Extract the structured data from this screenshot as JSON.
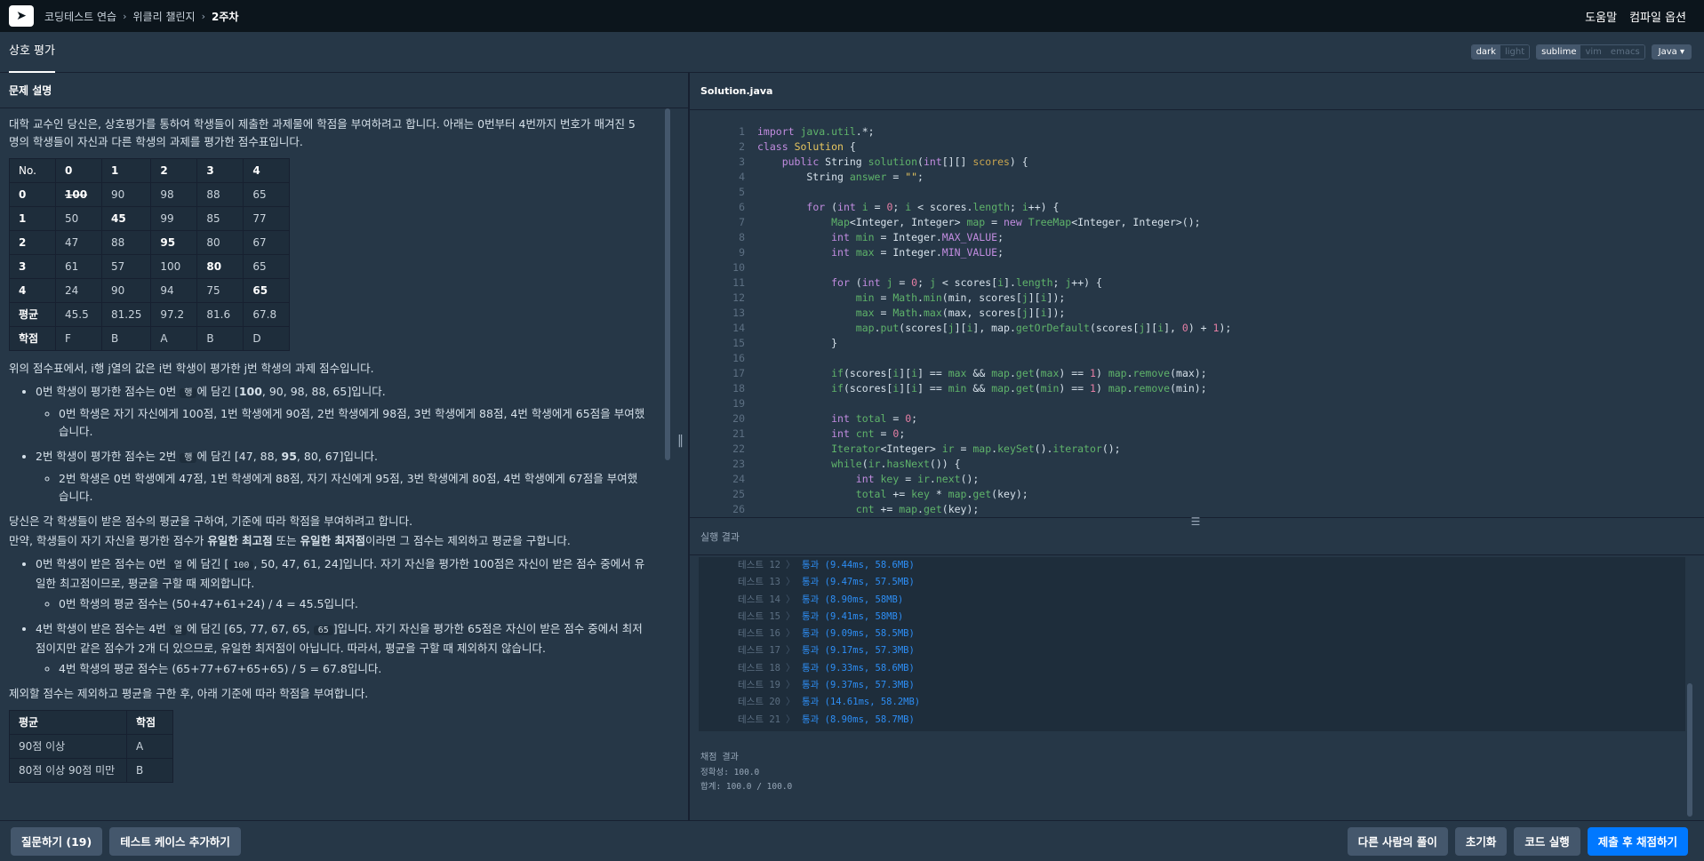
{
  "nav": {
    "crumbs": [
      "코딩테스트 연습",
      "위클리 챌린지",
      "2주차"
    ],
    "help": "도움말",
    "compile_options": "컴파일 옵션"
  },
  "subheader": {
    "tab": "상호 평가",
    "themes": [
      "dark",
      "light"
    ],
    "theme_selected": "dark",
    "keymaps": [
      "sublime",
      "vim",
      "emacs"
    ],
    "keymap_selected": "sublime",
    "language": "Java"
  },
  "problem": {
    "section_title": "문제 설명",
    "intro": "대학 교수인 당신은, 상호평가를 통하여 학생들이 제출한 과제물에 학점을 부여하려고 합니다. 아래는 0번부터 4번까지 번호가 매겨진 5명의 학생들이 자신과 다른 학생의 과제를 평가한 점수표입니다.",
    "score_table": {
      "header": [
        "No.",
        "0",
        "1",
        "2",
        "3",
        "4"
      ],
      "rows": [
        [
          "0",
          "100",
          "90",
          "98",
          "88",
          "65"
        ],
        [
          "1",
          "50",
          "45",
          "99",
          "85",
          "77"
        ],
        [
          "2",
          "47",
          "88",
          "95",
          "80",
          "67"
        ],
        [
          "3",
          "61",
          "57",
          "100",
          "80",
          "65"
        ],
        [
          "4",
          "24",
          "90",
          "94",
          "75",
          "65"
        ],
        [
          "평균",
          "45.5",
          "81.25",
          "97.2",
          "81.6",
          "67.8"
        ],
        [
          "학점",
          "F",
          "B",
          "A",
          "B",
          "D"
        ]
      ]
    },
    "table_note": "위의 점수표에서, i행 j열의 값은 i번 학생이 평가한 j번 학생의 과제 점수입니다.",
    "ex1_a": "0번 학생이 평가한 점수는 0번 ",
    "ex1_tag": "행",
    "ex1_b": "에 담긴 [",
    "ex1_bold": "100",
    "ex1_c": ", 90, 98, 88, 65]입니다.",
    "ex1_sub": "0번 학생은 자기 자신에게 100점, 1번 학생에게 90점, 2번 학생에게 98점, 3번 학생에게 88점, 4번 학생에게 65점을 부여했습니다.",
    "ex2_a": "2번 학생이 평가한 점수는 2번 ",
    "ex2_tag": "행",
    "ex2_b": "에 담긴 [47, 88, ",
    "ex2_bold": "95",
    "ex2_c": ", 80, 67]입니다.",
    "ex2_sub": "2번 학생은 0번 학생에게 47점, 1번 학생에게 88점, 자기 자신에게 95점, 3번 학생에게 80점, 4번 학생에게 67점을 부여했습니다.",
    "avg_intro": "당신은 각 학생들이 받은 점수의 평균을 구하여, 기준에 따라 학점을 부여하려고 합니다.",
    "rule_a": "만약, 학생들이 자기 자신을 평가한 점수가 ",
    "rule_b1": "유일한 최고점",
    "rule_mid": " 또는 ",
    "rule_b2": "유일한 최저점",
    "rule_c": "이라면 그 점수는 제외하고 평균을 구합니다.",
    "ex3_a": "0번 학생이 받은 점수는 0번 ",
    "ex3_tag": "열",
    "ex3_b": "에 담긴 [",
    "ex3_tag2": "100",
    "ex3_c": ", 50, 47, 61, 24]입니다. 자기 자신을 평가한 100점은 자신이 받은 점수 중에서 유일한 최고점이므로, 평균을 구할 때 제외합니다.",
    "ex3_sub": "0번 학생의 평균 점수는 (50+47+61+24) / 4 = 45.5입니다.",
    "ex4_a": "4번 학생이 받은 점수는 4번 ",
    "ex4_tag": "열",
    "ex4_b": "에 담긴 [65, 77, 67, 65, ",
    "ex4_tag2": "65",
    "ex4_c": "]입니다. 자기 자신을 평가한 65점은 자신이 받은 점수 중에서 최저점이지만 같은 점수가 2개 더 있으므로, 유일한 최저점이 아닙니다. 따라서, 평균을 구할 때 제외하지 않습니다.",
    "ex4_sub": "4번 학생의 평균 점수는 (65+77+67+65+65) / 5 = 67.8입니다.",
    "grade_intro": "제외할 점수는 제외하고 평균을 구한 후, 아래 기준에 따라 학점을 부여합니다.",
    "grade_table": {
      "header": [
        "평균",
        "학점"
      ],
      "rows": [
        [
          "90점 이상",
          "A"
        ],
        [
          "80점 이상 90점 미만",
          "B"
        ]
      ]
    }
  },
  "editor": {
    "filename": "Solution.java",
    "line_numbers": [
      "1",
      "2",
      "3",
      "4",
      "5",
      "6",
      "7",
      "8",
      "9",
      "10",
      "11",
      "12",
      "13",
      "14",
      "15",
      "16",
      "17",
      "18",
      "19",
      "20",
      "21",
      "22",
      "23",
      "24",
      "25",
      "26"
    ]
  },
  "results": {
    "section_title": "실행 결과",
    "tests": [
      {
        "label": "테스트 12",
        "value": "통과 (9.44ms, 58.6MB)"
      },
      {
        "label": "테스트 13",
        "value": "통과 (9.47ms, 57.5MB)"
      },
      {
        "label": "테스트 14",
        "value": "통과 (8.90ms, 58MB)"
      },
      {
        "label": "테스트 15",
        "value": "통과 (9.41ms, 58MB)"
      },
      {
        "label": "테스트 16",
        "value": "통과 (9.09ms, 58.5MB)"
      },
      {
        "label": "테스트 17",
        "value": "통과 (9.17ms, 57.3MB)"
      },
      {
        "label": "테스트 18",
        "value": "통과 (9.33ms, 58.6MB)"
      },
      {
        "label": "테스트 19",
        "value": "통과 (9.37ms, 57.3MB)"
      },
      {
        "label": "테스트 20",
        "value": "통과 (14.61ms, 58.2MB)"
      },
      {
        "label": "테스트 21",
        "value": "통과 (8.90ms, 58.7MB)"
      }
    ],
    "grading_title": "채점 결과",
    "accuracy": "정확성: 100.0",
    "total": "합계: 100.0 / 100.0"
  },
  "buttons": {
    "question": "질문하기 (19)",
    "add_testcase": "테스트 케이스 추가하기",
    "others_solutions": "다른 사람의 풀이",
    "reset": "초기화",
    "run": "코드 실행",
    "submit": "제출 후 채점하기"
  },
  "colors": {
    "nav_bg": "#0c151c",
    "panel_bg": "#263747",
    "accent": "#0078ff",
    "pass": "#2d8ef5"
  }
}
